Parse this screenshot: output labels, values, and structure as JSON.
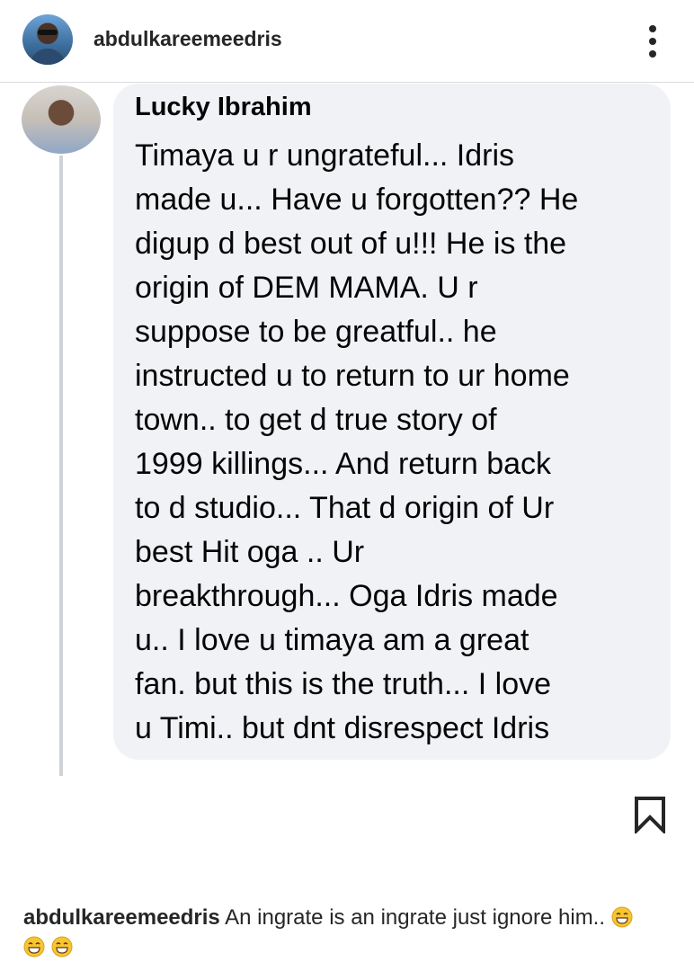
{
  "post_header": {
    "username": "abdulkareemeedris",
    "more_icon": "more-vertical-icon"
  },
  "comment": {
    "author": "Lucky Ibrahim",
    "text": "Timaya u r ungrateful... Idris\nmade u... Have u forgotten?? He\ndigup d best out of u!!! He is the\norigin of DEM MAMA. U r\nsuppose to be greatful.. he\ninstructed u to return to ur home\ntown.. to get d true story of\n1999 killings... And return back\nto d studio... That d origin of Ur\nbest Hit oga .. Ur\nbreakthrough... Oga Idris made\nu.. I love u timaya am a great\nfan. but this is the truth...  I love\nu Timi.. but dnt disrespect Idris"
  },
  "actions": {
    "bookmark_icon": "bookmark-icon"
  },
  "caption": {
    "username": "abdulkareemeedris",
    "text": "An ingrate is an ingrate just ignore him..",
    "emoji": "grinning-face-emoji"
  },
  "colors": {
    "bubble": "#f0f2f5",
    "text": "#262626",
    "divider": "#dbdbdb",
    "emoji": "#f7c531"
  }
}
